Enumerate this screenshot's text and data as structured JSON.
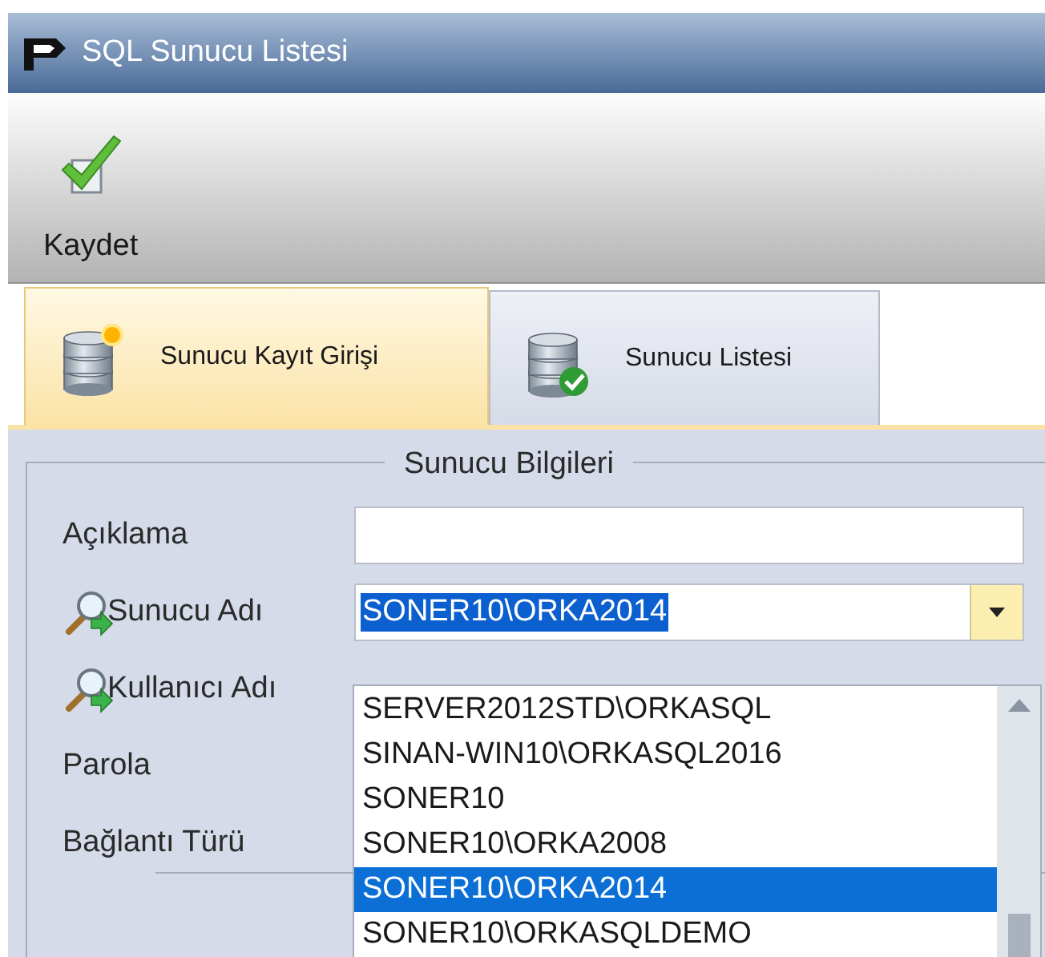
{
  "window": {
    "title": "SQL Sunucu Listesi"
  },
  "toolbar": {
    "buttons": [
      {
        "label": "Kaydet"
      }
    ]
  },
  "tabs": [
    {
      "label": "Sunucu Kayıt Girişi",
      "selected": true,
      "kind": "new"
    },
    {
      "label": "Sunucu Listesi",
      "selected": false,
      "kind": "list"
    }
  ],
  "group": {
    "title": "Sunucu Bilgileri",
    "fields": [
      {
        "label": "Açıklama",
        "kind": "text",
        "lookup": false
      },
      {
        "label": "Sunucu Adı",
        "kind": "combo",
        "lookup": true,
        "value": "SONER10\\ORKA2014"
      },
      {
        "label": "Kullanıcı Adı",
        "kind": "hidden",
        "lookup": true
      },
      {
        "label": "Parola",
        "kind": "hidden",
        "lookup": false
      },
      {
        "label": "Bağlantı Türü",
        "kind": "hidden",
        "lookup": false
      }
    ]
  },
  "dropdown": {
    "items": [
      {
        "label": "SERVER2012STD\\ORKASQL",
        "selected": false
      },
      {
        "label": "SINAN-WIN10\\ORKASQL2016",
        "selected": false
      },
      {
        "label": "SONER10",
        "selected": false
      },
      {
        "label": "SONER10\\ORKA2008",
        "selected": false
      },
      {
        "label": "SONER10\\ORKA2014",
        "selected": true
      },
      {
        "label": "SONER10\\ORKASQLDEMO",
        "selected": false
      }
    ]
  }
}
